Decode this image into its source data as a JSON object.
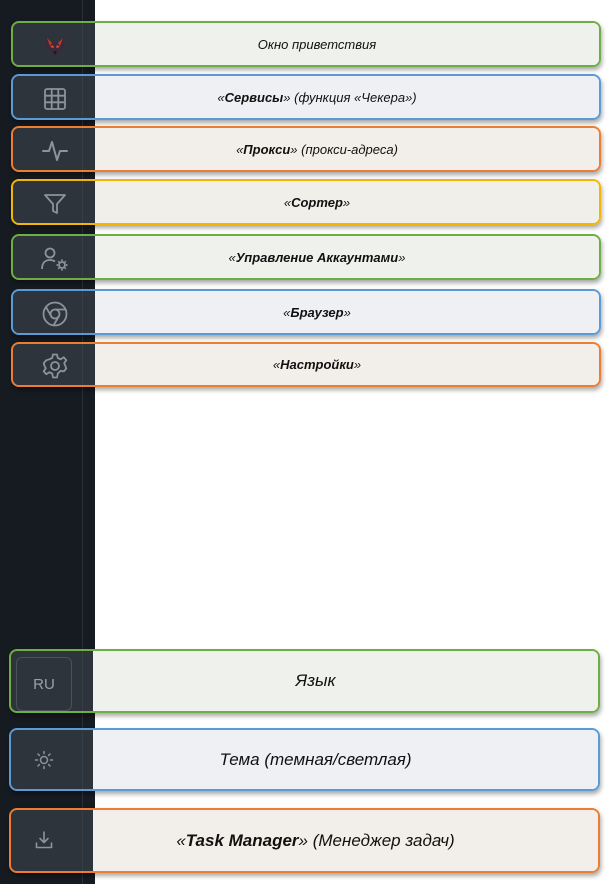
{
  "nav": [
    {
      "id": "welcome",
      "icon": "fox-logo-icon",
      "pre": "",
      "bold": "",
      "post": "Окно приветствия",
      "color": "green"
    },
    {
      "id": "services",
      "icon": "grid-icon",
      "pre": "«",
      "bold": "Сервисы",
      "post": "» (функция «Чекера»)",
      "color": "blue"
    },
    {
      "id": "proxy",
      "icon": "activity-icon",
      "pre": "«",
      "bold": "Прокси",
      "post": "» (прокси-адреса)",
      "color": "orange"
    },
    {
      "id": "sorter",
      "icon": "filter-icon",
      "pre": "«",
      "bold": "Сортер",
      "post": "»",
      "color": "yellow"
    },
    {
      "id": "accounts",
      "icon": "user-settings-icon",
      "pre": "«",
      "bold": "Управление Аккаунтами",
      "post": "»",
      "color": "green"
    },
    {
      "id": "browser",
      "icon": "chrome-icon",
      "pre": "«",
      "bold": "Браузер",
      "post": "»",
      "color": "blue"
    },
    {
      "id": "settings",
      "icon": "gear-icon",
      "pre": "«",
      "bold": "Настройки",
      "post": "»",
      "color": "orange"
    }
  ],
  "bottom": {
    "language": {
      "button": "RU",
      "label": "Язык",
      "color": "green"
    },
    "theme": {
      "icon": "sun-icon",
      "label": "Тема (темная/светлая)",
      "color": "blue"
    },
    "task_manager": {
      "icon": "download-icon",
      "pre": "«",
      "bold": "Task Manager",
      "post": "» (Менеджер задач)",
      "color": "orange"
    }
  }
}
